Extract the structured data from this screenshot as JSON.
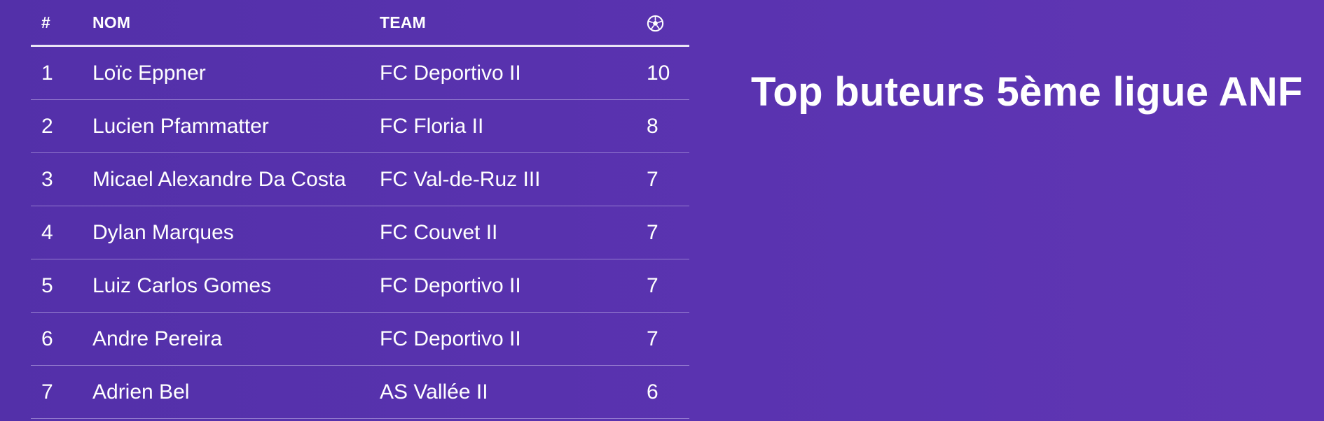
{
  "title": "Top buteurs 5ème ligue ANF",
  "table": {
    "headers": {
      "rank": "#",
      "name": "NOM",
      "team": "TEAM",
      "goals_icon": "soccer-ball-icon"
    },
    "rows": [
      {
        "rank": "1",
        "name": "Loïc Eppner",
        "team": "FC Deportivo II",
        "goals": "10"
      },
      {
        "rank": "2",
        "name": "Lucien Pfammatter",
        "team": "FC Floria II",
        "goals": "8"
      },
      {
        "rank": "3",
        "name": "Micael Alexandre Da Costa",
        "team": "FC Val-de-Ruz III",
        "goals": "7"
      },
      {
        "rank": "4",
        "name": "Dylan Marques",
        "team": "FC Couvet II",
        "goals": "7"
      },
      {
        "rank": "5",
        "name": "Luiz Carlos Gomes",
        "team": "FC Deportivo II",
        "goals": "7"
      },
      {
        "rank": "6",
        "name": "Andre Pereira",
        "team": "FC Deportivo II",
        "goals": "7"
      },
      {
        "rank": "7",
        "name": "Adrien Bel",
        "team": "AS Vallée II",
        "goals": "6"
      }
    ]
  },
  "colors": {
    "background": "#5a33b0",
    "text": "#ffffff",
    "header_rule": "#e9e4f5"
  }
}
